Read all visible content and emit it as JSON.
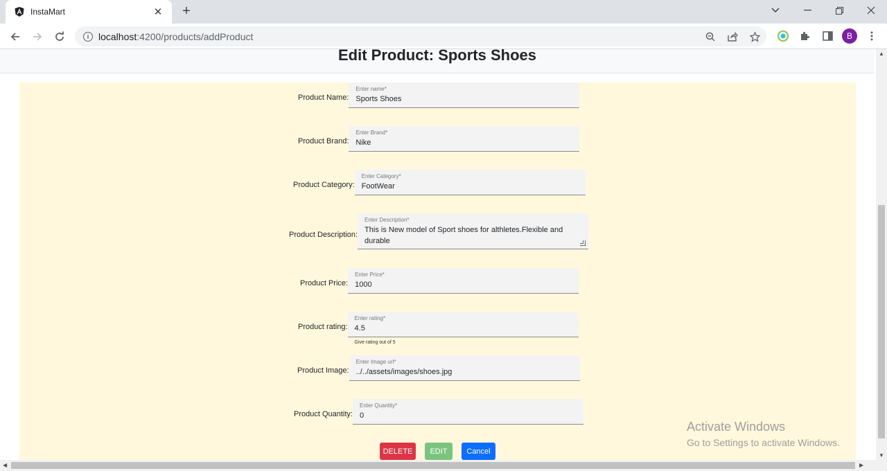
{
  "browser": {
    "tab_title": "InstaMart",
    "url_host": "localhost",
    "url_rest": ":4200/products/addProduct",
    "profile_initial": "B",
    "icons": [
      "angular-favicon",
      "close-icon",
      "plus-icon",
      "chevron-down-icon",
      "minimize-icon",
      "restore-icon",
      "close-window-icon",
      "back-icon",
      "forward-icon",
      "reload-icon",
      "info-icon",
      "zoom-icon",
      "share-icon",
      "star-icon",
      "extension-icon",
      "puzzle-icon",
      "sidepanel-icon",
      "menu-icon"
    ]
  },
  "page": {
    "title": "Edit Product: Sports Shoes"
  },
  "form": {
    "name": {
      "label": "Product Name:",
      "float_label": "Enter name*",
      "value": "Sports Shoes"
    },
    "brand": {
      "label": "Product Brand:",
      "float_label": "Enter Brand*",
      "value": "Nike"
    },
    "category": {
      "label": "Product Category:",
      "float_label": "Enter Category*",
      "value": "FootWear"
    },
    "description": {
      "label": "Product Description:",
      "float_label": "Enter Description*",
      "value": "This is New model of Sport shoes for althletes.Flexible and durable"
    },
    "price": {
      "label": "Product Price:",
      "float_label": "Enter Price*",
      "value": "1000"
    },
    "rating": {
      "label": "Product rating:",
      "float_label": "Enter rating*",
      "value": "4.5",
      "hint": "Give rating out of 5"
    },
    "image": {
      "label": "Product Image:",
      "float_label": "Enter Image url*",
      "value": "../../assets/images/shoes.jpg"
    },
    "quantity": {
      "label": "Product Quantity:",
      "float_label": "Enter Quantity*",
      "value": "0"
    }
  },
  "buttons": {
    "delete": "DELETE",
    "edit": "EDIT",
    "cancel": "Cancel"
  },
  "colors": {
    "form_background": "#fff8dc",
    "delete": "#dc3545",
    "edit": "#7bc47f",
    "cancel": "#0d6efd"
  },
  "watermark": {
    "line1": "Activate Windows",
    "line2": "Go to Settings to activate Windows."
  }
}
